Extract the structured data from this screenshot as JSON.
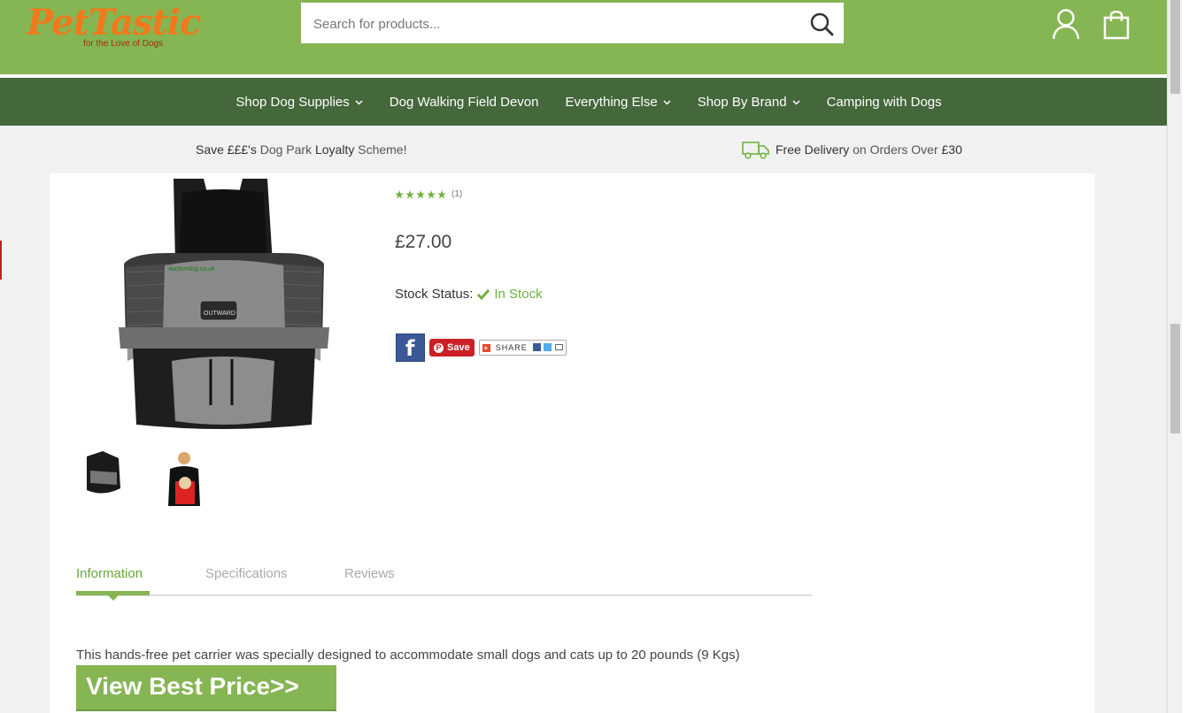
{
  "header": {
    "logo_text": "PetTastic",
    "logo_tagline": "for the Love of Dogs",
    "search_placeholder": "Search for products...",
    "icons": [
      "search-icon",
      "account-icon",
      "cart-icon"
    ]
  },
  "nav": {
    "items": [
      {
        "label": "Shop Dog Supplies",
        "dropdown": true
      },
      {
        "label": "Dog Walking Field Devon",
        "dropdown": false
      },
      {
        "label": "Everything Else",
        "dropdown": true
      },
      {
        "label": "Shop By Brand",
        "dropdown": true
      },
      {
        "label": "Camping with Dogs",
        "dropdown": false
      }
    ]
  },
  "promo": {
    "left_part1": "Save £££'s",
    "left_part2": " Dog Park ",
    "left_part3": "Loyalty",
    "left_part4": " Scheme!",
    "right_part1": "Free Delivery",
    "right_part2": " on Orders Over ",
    "right_part3": "£30"
  },
  "product": {
    "image_watermark": "4activedog.co.uk",
    "rating_count": "(1)",
    "rating_stars": 5,
    "price": "£27.00",
    "stock_label": "Stock Status:",
    "stock_value": "In Stock",
    "share": {
      "facebook": "f",
      "pinterest_label": "Save",
      "share_label": "SHARE"
    }
  },
  "tabs": {
    "items": [
      "Information",
      "Specifications",
      "Reviews"
    ],
    "active": 0
  },
  "description": "This hands-free pet carrier was specially designed to accommodate small dogs and cats up to 20 pounds (9 Kgs)",
  "cta_label": "View Best Price>>",
  "colors": {
    "header_green": "#86b553",
    "nav_green": "#44673b",
    "logo_orange": "#f07a1b",
    "accent_green": "#6aa63a"
  }
}
